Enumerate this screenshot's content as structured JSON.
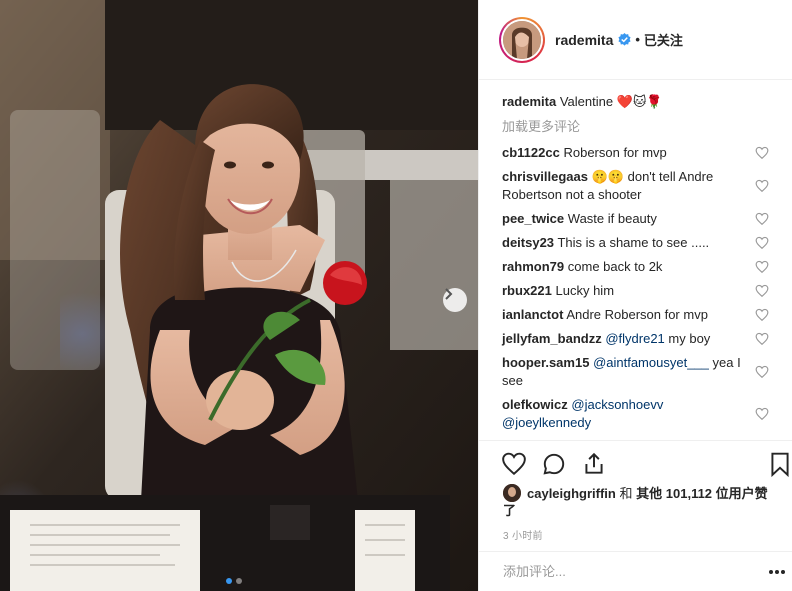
{
  "post": {
    "username": "rademita",
    "follow_status": "已关注",
    "separator": "•",
    "caption_text": "Valentine ❤️🐱🌹",
    "load_more_label": "加载更多评论"
  },
  "comments": [
    {
      "user": "cb1122cc",
      "text": "Roberson for mvp"
    },
    {
      "user": "chrisvillegaas",
      "text": "🤫🤫 don't tell Andre Robertson not a shooter"
    },
    {
      "user": "pee_twice",
      "text": "Waste if beauty"
    },
    {
      "user": "deitsy23",
      "text": "This is a shame to see ....."
    },
    {
      "user": "rahmon79",
      "text": "come back to 2k"
    },
    {
      "user": "rbux221",
      "text": "Lucky him"
    },
    {
      "user": "ianlanctot",
      "text": "Andre Roberson for mvp"
    },
    {
      "user": "jellyfam_bandzz",
      "mention": "@flydre21",
      "text": " my boy"
    },
    {
      "user": "hooper.sam15",
      "mention": "@aintfamousyet___",
      "text": " yea I see"
    },
    {
      "user": "olefkowicz",
      "mention": "@jacksonhoevv",
      "mention2": "@joeylkennedy",
      "text": ""
    }
  ],
  "likes": {
    "liker": "cayleighgriffin",
    "connector": "和",
    "others_label": "其他",
    "count": "101,112",
    "suffix": "位用户赞了"
  },
  "timestamp": "3 小时前",
  "add_comment_placeholder": "添加评论...",
  "icons": {
    "like": "heart-outline-icon",
    "comment": "speech-bubble-icon",
    "share": "share-arrow-icon",
    "save": "bookmark-icon",
    "more": "ellipsis-icon",
    "next": "chevron-right-icon",
    "verified": "verified-badge-icon"
  },
  "colors": {
    "text": "#262626",
    "muted": "#999999",
    "mention": "#003569",
    "verified": "#3897f0",
    "divider": "#efefef"
  },
  "carousel": {
    "slides": 2,
    "active": 1
  }
}
